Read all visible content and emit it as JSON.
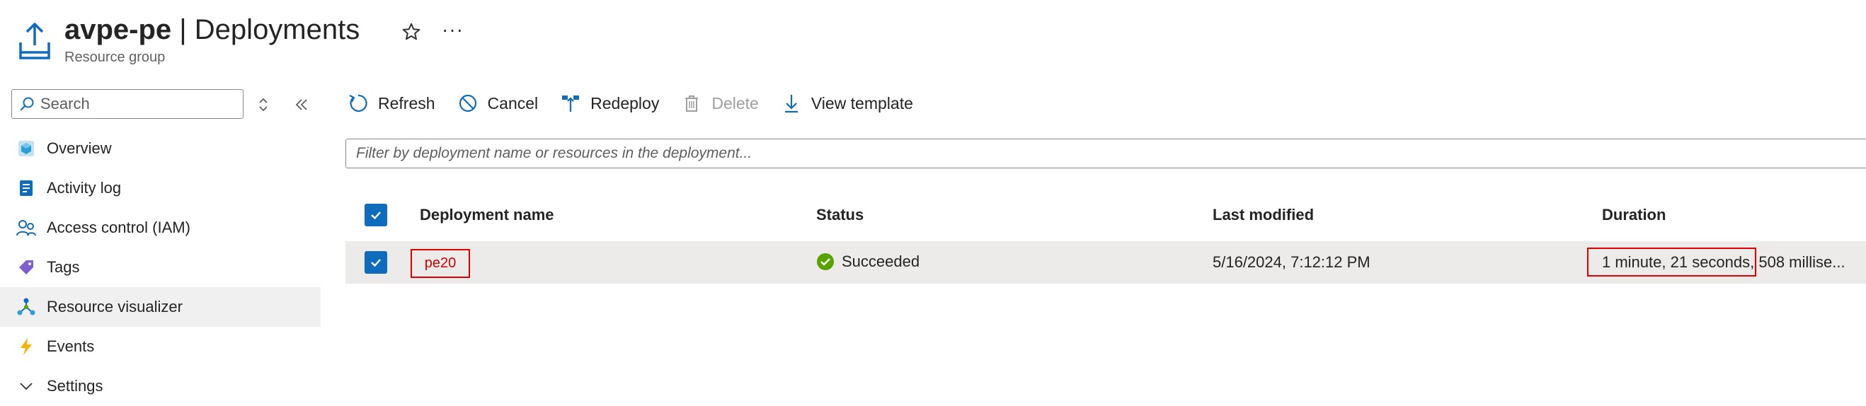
{
  "header": {
    "resource_name": "avpe-pe",
    "separator": " | ",
    "page_title": "Deployments",
    "subtitle": "Resource group",
    "favorite_icon": "star-icon",
    "more_icon": "more-icon",
    "more_label": "···"
  },
  "sidebar": {
    "search_placeholder": "Search",
    "items": [
      {
        "label": "Overview",
        "icon": "overview-icon"
      },
      {
        "label": "Activity log",
        "icon": "activity-log-icon"
      },
      {
        "label": "Access control (IAM)",
        "icon": "iam-icon"
      },
      {
        "label": "Tags",
        "icon": "tag-icon"
      },
      {
        "label": "Resource visualizer",
        "icon": "visualizer-icon",
        "active": true
      },
      {
        "label": "Events",
        "icon": "lightning-icon"
      },
      {
        "label": "Settings",
        "icon": "chevron-down-icon"
      }
    ]
  },
  "toolbar": {
    "refresh": "Refresh",
    "cancel": "Cancel",
    "redeploy": "Redeploy",
    "delete": "Delete",
    "view_template": "View template"
  },
  "filter": {
    "placeholder": "Filter by deployment name or resources in the deployment..."
  },
  "table": {
    "columns": [
      "Deployment name",
      "Status",
      "Last modified",
      "Duration"
    ],
    "rows": [
      {
        "name": "pe20",
        "status": "Succeeded",
        "last_modified": "5/16/2024, 7:12:12 PM",
        "duration_highlight": "1 minute, 21 seconds",
        "duration_rest": ", 508 millise..."
      }
    ]
  },
  "colors": {
    "accent": "#0f6cbd",
    "highlight_border": "#e00000",
    "success": "#57a300"
  }
}
